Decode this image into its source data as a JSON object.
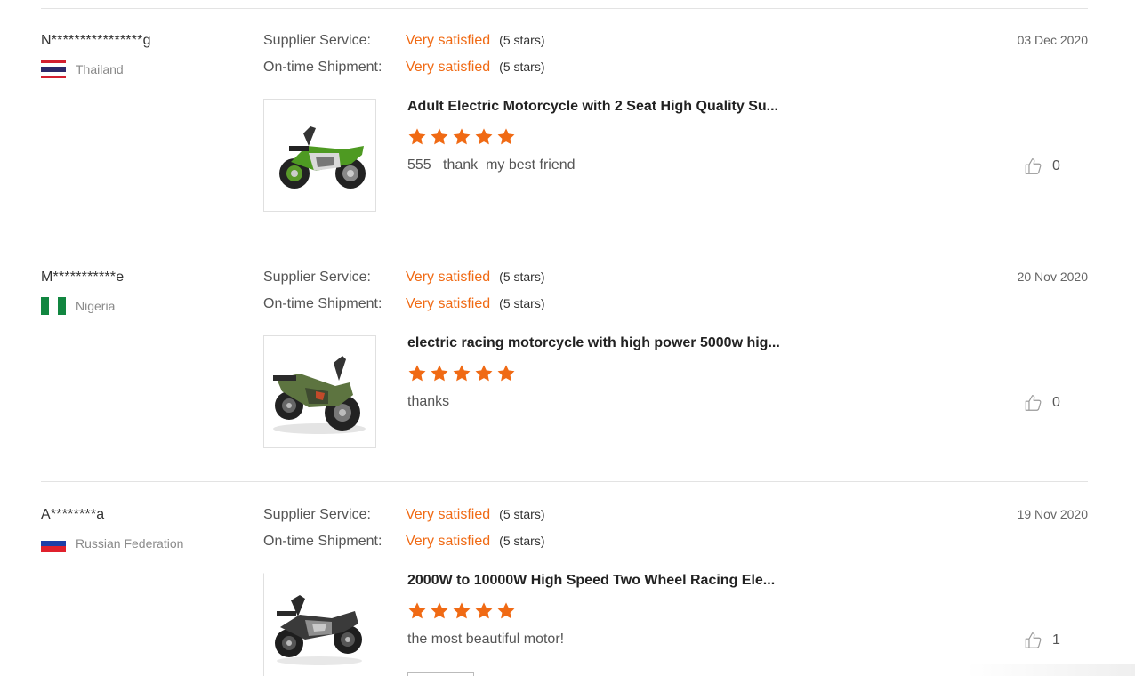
{
  "colors": {
    "accent": "#f06a14",
    "divider": "#e3e3e3"
  },
  "icons": {
    "like": "thumbs-up-icon",
    "star": "star-icon"
  },
  "reviews": [
    {
      "buyer": "N****************g",
      "country": "Thailand",
      "flag": "thailand-flag",
      "supplier_service_label": "Supplier Service:",
      "supplier_service_value": "Very satisfied",
      "supplier_service_stars": "(5 stars)",
      "shipment_label": "On-time Shipment:",
      "shipment_value": "Very satisfied",
      "shipment_stars": "(5 stars)",
      "date": "03 Dec 2020",
      "product_title": "Adult Electric Motorcycle with 2 Seat High Quality Su...",
      "product_image": "green electric motorcycle",
      "product_stars": 5,
      "text": "555   thank  my best friend",
      "likes": "0"
    },
    {
      "buyer": "M***********e",
      "country": "Nigeria",
      "flag": "nigeria-flag",
      "supplier_service_label": "Supplier Service:",
      "supplier_service_value": "Very satisfied",
      "supplier_service_stars": "(5 stars)",
      "shipment_label": "On-time Shipment:",
      "shipment_value": "Very satisfied",
      "shipment_stars": "(5 stars)",
      "date": "20 Nov 2020",
      "product_title": "electric racing motorcycle with high power 5000w hig...",
      "product_image": "dark green electric motorcycle",
      "product_stars": 5,
      "text": "thanks",
      "likes": "0"
    },
    {
      "buyer": "A********a",
      "country": "Russian Federation",
      "flag": "russia-flag",
      "supplier_service_label": "Supplier Service:",
      "supplier_service_value": "Very satisfied",
      "supplier_service_stars": "(5 stars)",
      "shipment_label": "On-time Shipment:",
      "shipment_value": "Very satisfied",
      "shipment_stars": "(5 stars)",
      "date": "19 Nov 2020",
      "product_title": "2000W to 10000W High Speed Two Wheel Racing Ele...",
      "product_image": "grey electric motorcycle",
      "product_stars": 5,
      "text": "the most beautiful motor!",
      "likes": "1"
    }
  ]
}
